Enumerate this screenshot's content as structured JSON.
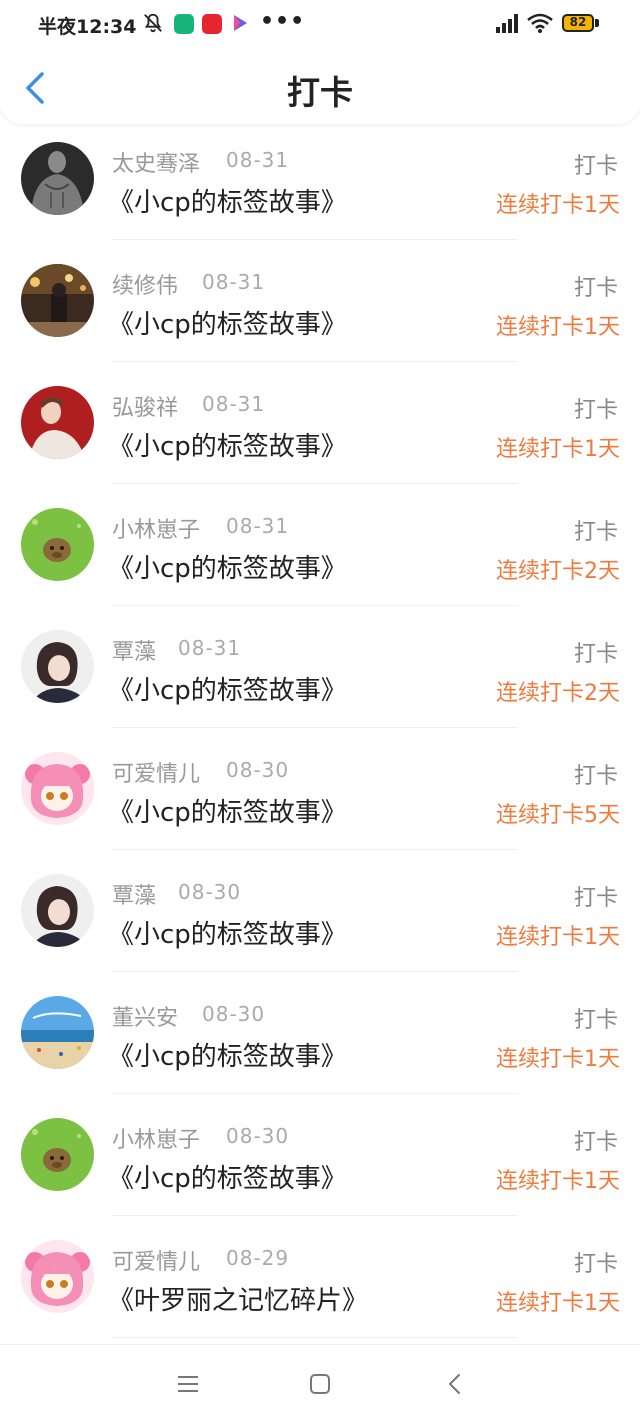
{
  "status_bar": {
    "time": "半夜12:34",
    "dots": "•••",
    "battery": "82",
    "icons": [
      "bell-off-icon",
      "shield-app-icon",
      "red-app-icon",
      "play-app-icon",
      "signal-icon",
      "wifi-icon",
      "battery-icon"
    ]
  },
  "header": {
    "title": "打卡",
    "back_icon": "chevron-left-icon",
    "accent_color": "#3a8ee6"
  },
  "colors": {
    "streak": "#f07a3c",
    "name": "#999999",
    "title": "#222222"
  },
  "items": [
    {
      "name": "太史骞泽",
      "date": "08-31",
      "title": "《小cp的标签故事》",
      "action": "打卡",
      "streak": "连续打卡1天",
      "avatar": "muscle-man"
    },
    {
      "name": "续修伟",
      "date": "08-31",
      "title": "《小cp的标签故事》",
      "action": "打卡",
      "streak": "连续打卡1天",
      "avatar": "night-street"
    },
    {
      "name": "弘骏祥",
      "date": "08-31",
      "title": "《小cp的标签故事》",
      "action": "打卡",
      "streak": "连续打卡1天",
      "avatar": "red-portrait"
    },
    {
      "name": "小林崽子",
      "date": "08-31",
      "title": "《小cp的标签故事》",
      "action": "打卡",
      "streak": "连续打卡2天",
      "avatar": "capybara-green"
    },
    {
      "name": "覃藻",
      "date": "08-31",
      "title": "《小cp的标签故事》",
      "action": "打卡",
      "streak": "连续打卡2天",
      "avatar": "girl-bob"
    },
    {
      "name": "可爱情儿",
      "date": "08-30",
      "title": "《小cp的标签故事》",
      "action": "打卡",
      "streak": "连续打卡5天",
      "avatar": "anime-pink"
    },
    {
      "name": "覃藻",
      "date": "08-30",
      "title": "《小cp的标签故事》",
      "action": "打卡",
      "streak": "连续打卡1天",
      "avatar": "girl-bob"
    },
    {
      "name": "董兴安",
      "date": "08-30",
      "title": "《小cp的标签故事》",
      "action": "打卡",
      "streak": "连续打卡1天",
      "avatar": "beach"
    },
    {
      "name": "小林崽子",
      "date": "08-30",
      "title": "《小cp的标签故事》",
      "action": "打卡",
      "streak": "连续打卡1天",
      "avatar": "capybara-green"
    },
    {
      "name": "可爱情儿",
      "date": "08-29",
      "title": "《叶罗丽之记忆碎片》",
      "action": "打卡",
      "streak": "连续打卡1天",
      "avatar": "anime-pink"
    }
  ],
  "nav_bar": {
    "icons": [
      "menu-icon",
      "home-square-icon",
      "back-triangle-icon"
    ]
  }
}
